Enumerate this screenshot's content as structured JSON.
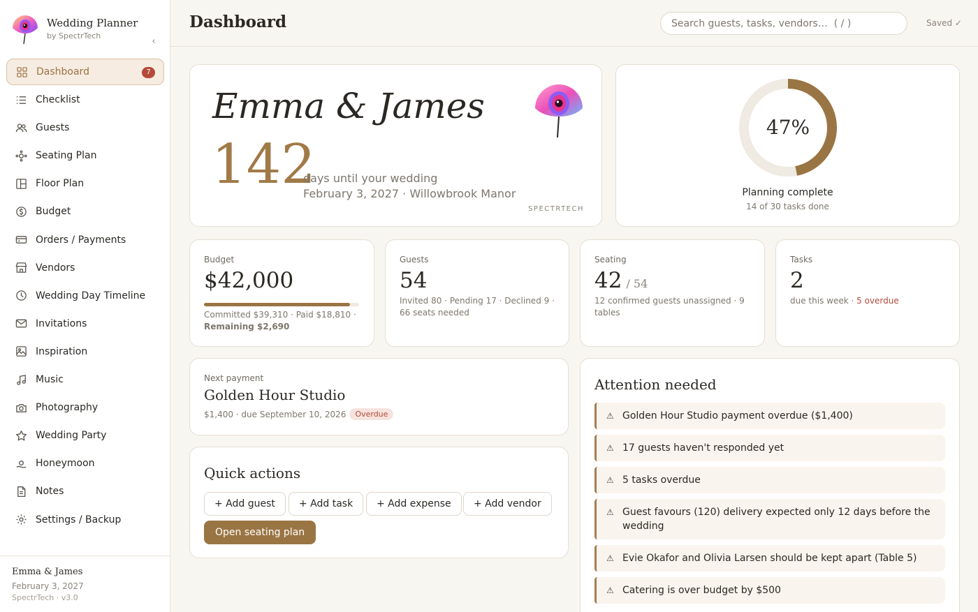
{
  "sidebar": {
    "brand_title": "Wedding Planner",
    "brand_subtitle": "by SpectrTech",
    "collapse_icon": "chevron-left-icon",
    "items": [
      {
        "label": "Dashboard",
        "icon": "grid-icon",
        "active": true,
        "badge": "7"
      },
      {
        "label": "Checklist",
        "icon": "list-icon"
      },
      {
        "label": "Guests",
        "icon": "users-icon"
      },
      {
        "label": "Seating Plan",
        "icon": "seating-icon"
      },
      {
        "label": "Floor Plan",
        "icon": "floorplan-icon"
      },
      {
        "label": "Budget",
        "icon": "dollar-icon"
      },
      {
        "label": "Orders / Payments",
        "icon": "card-icon"
      },
      {
        "label": "Vendors",
        "icon": "store-icon"
      },
      {
        "label": "Wedding Day Timeline",
        "icon": "clock-icon"
      },
      {
        "label": "Invitations",
        "icon": "mail-icon"
      },
      {
        "label": "Inspiration",
        "icon": "image-icon"
      },
      {
        "label": "Music",
        "icon": "music-icon"
      },
      {
        "label": "Photography",
        "icon": "camera-icon"
      },
      {
        "label": "Wedding Party",
        "icon": "star-icon"
      },
      {
        "label": "Honeymoon",
        "icon": "sunset-icon"
      },
      {
        "label": "Notes",
        "icon": "note-icon"
      },
      {
        "label": "Settings / Backup",
        "icon": "gear-icon"
      }
    ],
    "footer": {
      "couple": "Emma & James",
      "date": "February 3, 2027",
      "version": "SpectrTech · v3.0"
    }
  },
  "topbar": {
    "title": "Dashboard",
    "search_placeholder": "Search guests, tasks, vendors…  ( / )",
    "saved": "Saved ✓"
  },
  "hero": {
    "couple": "Emma & James",
    "days": "142",
    "days_label": "days until your wedding",
    "date_venue": "February 3, 2027 · Willowbrook Manor",
    "brand": "SPECTRTECH"
  },
  "progress": {
    "percent": 47,
    "percent_label": "47%",
    "title": "Planning complete",
    "subtitle": "14 of 30 tasks done"
  },
  "stats": {
    "budget": {
      "label": "Budget",
      "value": "$42,000",
      "fill_fraction": 0.94,
      "sub": "Committed $39,310 · Paid $18,810 ·",
      "remaining": "Remaining $2,690"
    },
    "guests": {
      "label": "Guests",
      "value": "54",
      "sub": "Invited 80 · Pending 17 · Declined 9 · 66 seats needed"
    },
    "seating": {
      "label": "Seating",
      "value": "42",
      "of": "/ 54",
      "sub": "12 confirmed guests unassigned · 9 tables"
    },
    "tasks": {
      "label": "Tasks",
      "value": "2",
      "sub": "due this week ·",
      "overdue": "5 overdue"
    }
  },
  "payment": {
    "label": "Next payment",
    "vendor": "Golden Hour Studio",
    "detail": "$1,400 · due September 10, 2026",
    "status": "Overdue"
  },
  "quick_actions": {
    "title": "Quick actions",
    "add_guest": "+ Add guest",
    "add_task": "+ Add task",
    "add_expense": "+ Add expense",
    "add_vendor": "+ Add vendor",
    "open_seating": "Open seating plan"
  },
  "attention": {
    "title": "Attention needed",
    "icon": "warning-icon",
    "items": [
      "Golden Hour Studio payment overdue ($1,400)",
      "17 guests haven't responded yet",
      "5 tasks overdue",
      "Guest favours (120) delivery expected only 12 days before the wedding",
      "Evie Okafor and Olivia Larsen should be kept apart (Table 5)",
      "Catering is over budget by $500"
    ]
  },
  "colors": {
    "accent": "#9a7544",
    "danger": "#b34a3a",
    "background": "#f8f6f1"
  }
}
